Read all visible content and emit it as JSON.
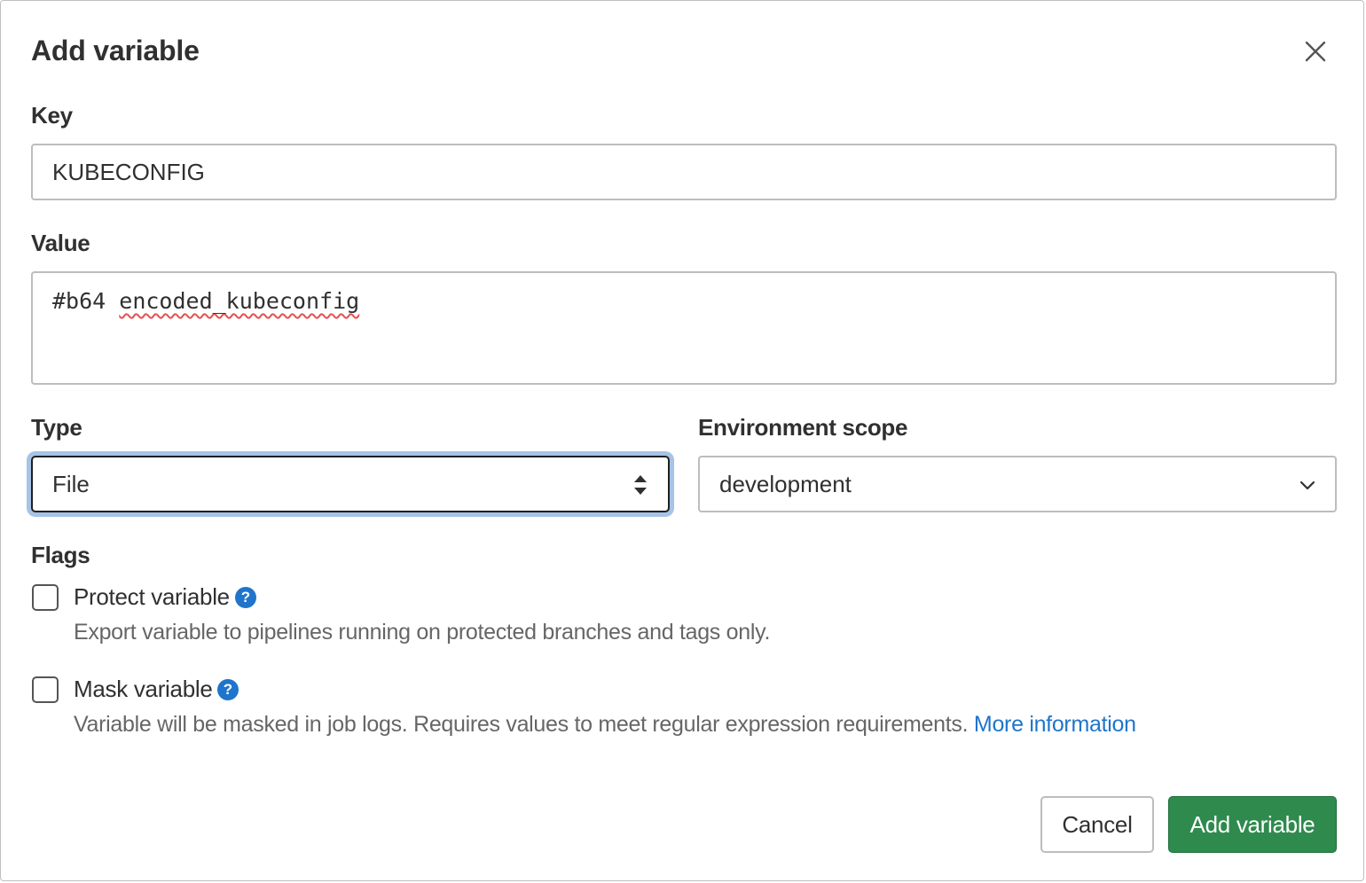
{
  "dialog": {
    "title": "Add variable",
    "close_icon": "close-icon"
  },
  "key": {
    "label": "Key",
    "value": "KUBECONFIG"
  },
  "value": {
    "label": "Value",
    "text_prefix": "#b64 ",
    "text_misspelled": "encoded_kubeconfig"
  },
  "type": {
    "label": "Type",
    "selected": "File",
    "icon": "sort-arrows-icon"
  },
  "environment_scope": {
    "label": "Environment scope",
    "selected": "development",
    "icon": "chevron-down-icon"
  },
  "flags": {
    "label": "Flags",
    "protect": {
      "label": "Protect variable",
      "checked": false,
      "description": "Export variable to pipelines running on protected branches and tags only."
    },
    "mask": {
      "label": "Mask variable",
      "checked": false,
      "description": "Variable will be masked in job logs. Requires values to meet regular expression requirements.",
      "link_text": "More information"
    },
    "help_glyph": "?"
  },
  "buttons": {
    "cancel": "Cancel",
    "add": "Add variable"
  },
  "colors": {
    "primary_button": "#2f8a4e",
    "link": "#1f75cb",
    "focus_ring": "#a7c3e6"
  }
}
